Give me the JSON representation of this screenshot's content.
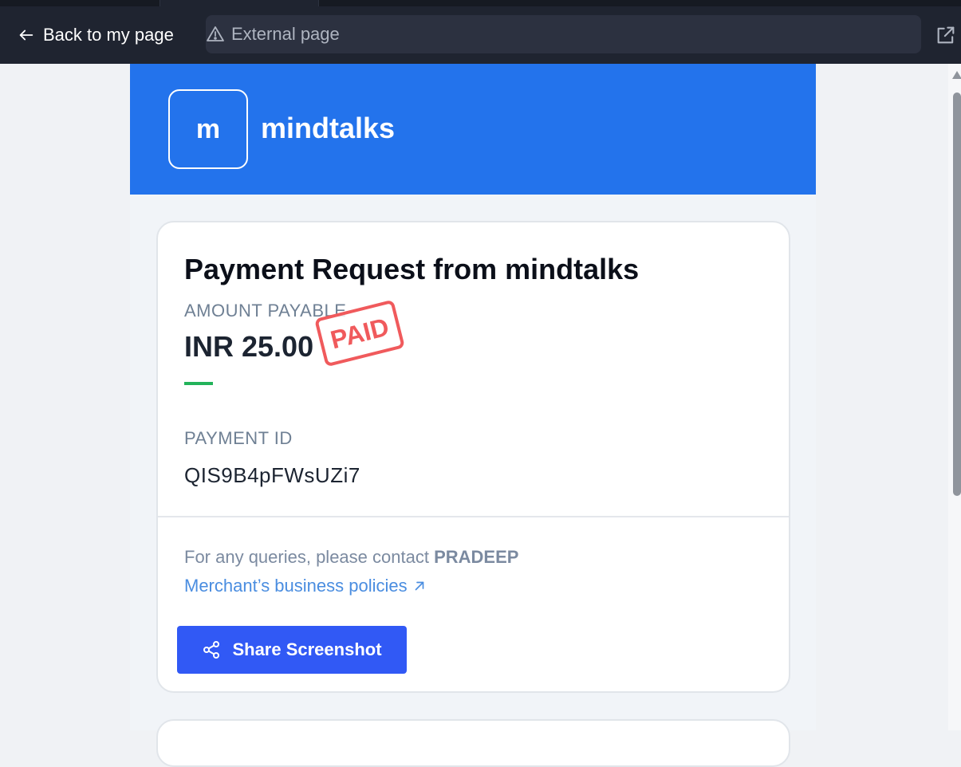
{
  "browser": {
    "back_label": "Back to my page",
    "url_text": "External page",
    "icons": {
      "back": "arrow-left-icon",
      "warning": "warning-triangle-icon",
      "external": "external-link-icon"
    }
  },
  "merchant": {
    "logo_letter": "m",
    "name": "mindtalks"
  },
  "payment": {
    "title": "Payment Request from mindtalks",
    "amount_label": "AMOUNT PAYABLE",
    "amount_value": "INR 25.00",
    "status_stamp": "PAID",
    "payment_id_label": "PAYMENT ID",
    "payment_id_value": "QIS9B4pFWsUZi7"
  },
  "footer": {
    "query_prefix": "For any queries, please contact ",
    "contact_name": "PRADEEP",
    "policies_link": "Merchant’s business policies",
    "share_button": "Share Screenshot"
  },
  "colors": {
    "header_blue": "#2373ec",
    "button_blue": "#3159f5",
    "stamp_red": "#f05a5c",
    "accent_green": "#22b35a",
    "link_blue": "#4a8de0"
  }
}
